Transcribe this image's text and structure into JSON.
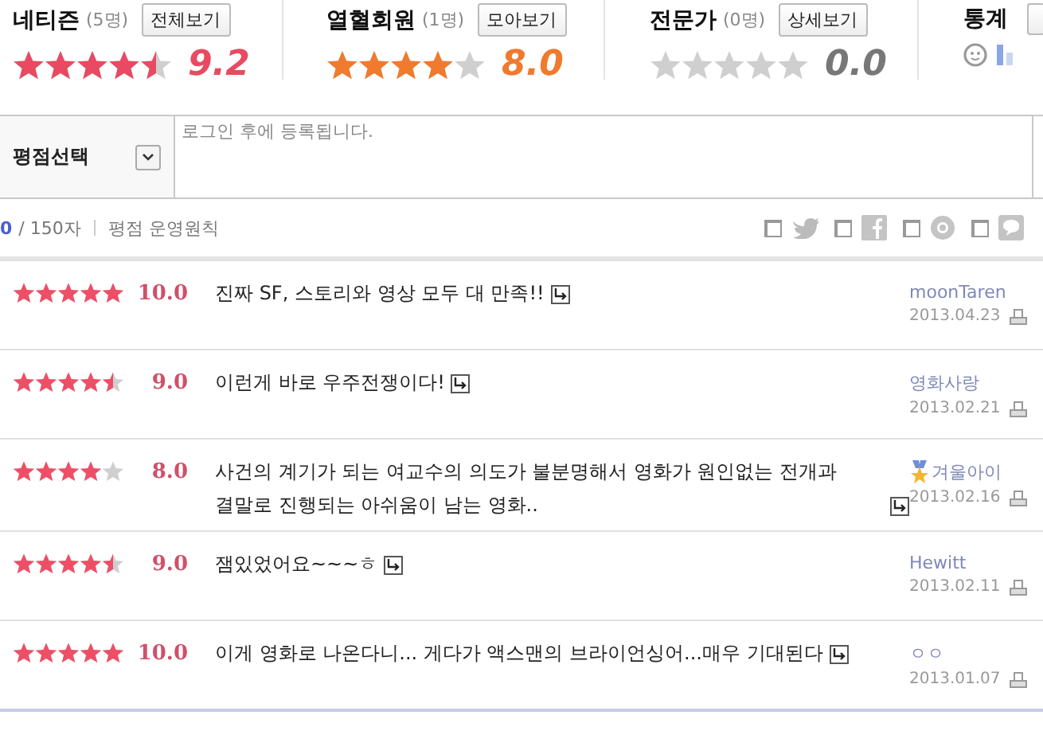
{
  "summaries": [
    {
      "title": "네티즌",
      "count": "(5명)",
      "button": "전체보기",
      "stars": 4.5,
      "score": "9.2",
      "color": "#e84a62"
    },
    {
      "title": "열혈회원",
      "count": "(1명)",
      "button": "모아보기",
      "stars": 4,
      "score": "8.0",
      "color": "#f07a2e"
    },
    {
      "title": "전문가",
      "count": "(0명)",
      "button": "상세보기",
      "stars": 0,
      "score": "0.0",
      "color": "#777777"
    }
  ],
  "stats": {
    "title": "통계"
  },
  "form": {
    "select": "평점선택",
    "placeholder": "로그인 후에 등록됩니다."
  },
  "counter": {
    "current": "0",
    "max": "/ 150자",
    "rules_link": "평점 운영원칙"
  },
  "share": [
    {
      "kind": "twitter",
      "checked": false
    },
    {
      "kind": "facebook",
      "checked": false
    },
    {
      "kind": "circle",
      "checked": false
    },
    {
      "kind": "bubble",
      "checked": false
    }
  ],
  "reviews": [
    {
      "stars": 5,
      "score": "10.0",
      "text": "진짜 SF, 스토리와 영상 모두 대 만족!!",
      "author": "moonTaren",
      "badge": false,
      "date": "2013.04.23"
    },
    {
      "stars": 4.5,
      "score": "9.0",
      "text": "이런게 바로 우주전쟁이다!",
      "author": "영화사랑",
      "badge": false,
      "date": "2013.02.21"
    },
    {
      "stars": 4,
      "score": "8.0",
      "text": "사건의 계기가 되는 여교수의 의도가 불분명해서 영화가 원인없는 전개과 결말로 진행되는 아쉬움이 남는 영화..",
      "author": "겨울아이",
      "badge": true,
      "date": "2013.02.16"
    },
    {
      "stars": 4.5,
      "score": "9.0",
      "text": "잼있었어요~~~ㅎ",
      "author": "Hewitt",
      "badge": false,
      "date": "2013.02.11"
    },
    {
      "stars": 5,
      "score": "10.0",
      "text": "이게 영화로 나온다니... 게다가 액스맨의 브라이언싱어...매우 기대된다",
      "author": "ㅇㅇ",
      "badge": false,
      "date": "2013.01.07"
    }
  ]
}
